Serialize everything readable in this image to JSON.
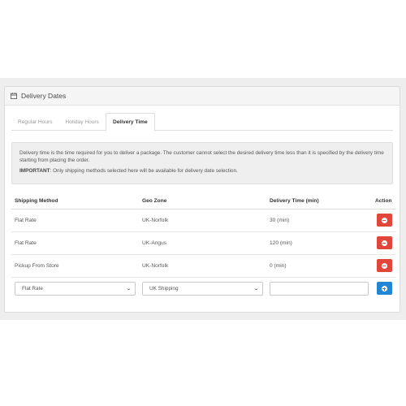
{
  "panel": {
    "title": "Delivery Dates",
    "icon": "calendar-icon"
  },
  "tabs": [
    {
      "label": "Regular Hours",
      "active": false
    },
    {
      "label": "Holiday Hours",
      "active": false
    },
    {
      "label": "Delivery Time",
      "active": true
    }
  ],
  "alert": {
    "text": "Delivery time is the time required for you to deliver a package. The customer cannot select the desired delivery time less than it is specified by the delivery time starting from placing the order.",
    "important_label": "IMPORTANT",
    "important_text": ": Only shipping methods selected here will be available for delivery date selection."
  },
  "table": {
    "headers": {
      "shipping_method": "Shipping Method",
      "geo_zone": "Geo Zone",
      "delivery_time": "Delivery Time (min)",
      "action": "Action"
    },
    "rows": [
      {
        "shipping_method": "Flat Rate",
        "geo_zone": "UK-Norfolk",
        "delivery_time": "30 (min)"
      },
      {
        "shipping_method": "Flat Rate",
        "geo_zone": "UK-Angus",
        "delivery_time": "120 (min)"
      },
      {
        "shipping_method": "Pickup From Store",
        "geo_zone": "UK-Norfolk",
        "delivery_time": "0 (min)"
      }
    ],
    "new_row": {
      "shipping_method_selected": "Flat Rate",
      "geo_zone_selected": "UK Shipping",
      "delivery_time_value": ""
    }
  },
  "colors": {
    "danger": "#e2463b",
    "primary": "#2186d4"
  }
}
